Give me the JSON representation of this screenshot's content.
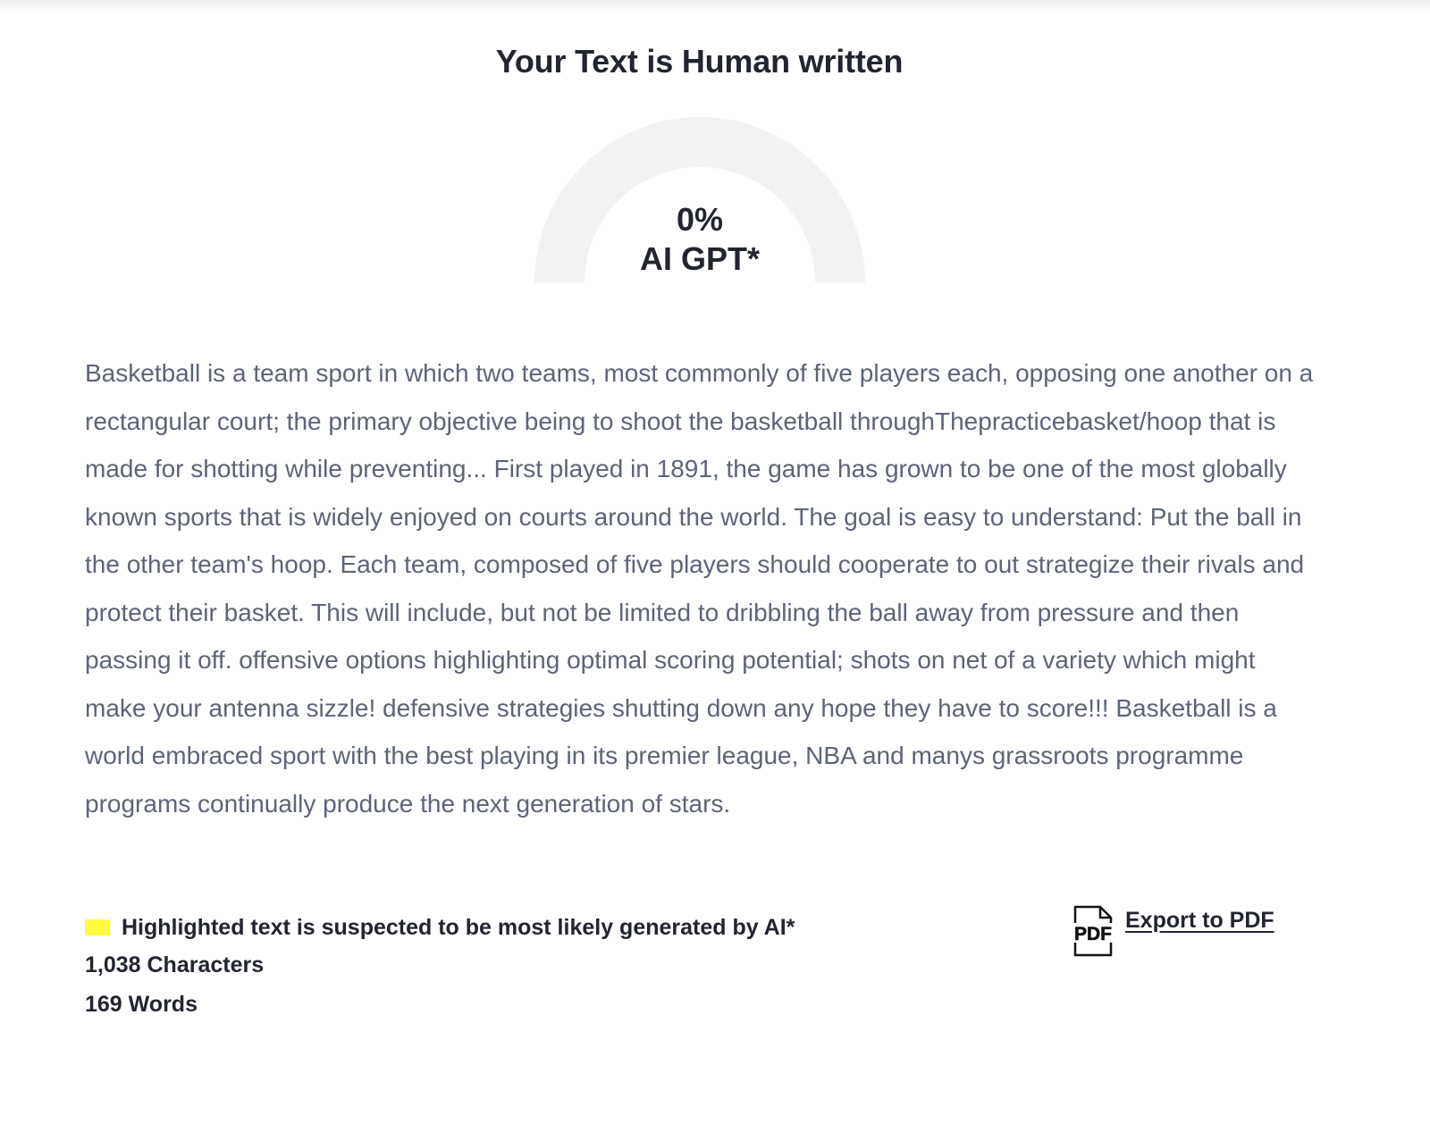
{
  "result": {
    "title": "Your Text is Human written"
  },
  "gauge": {
    "ai_percent": 0,
    "value_text": "0%",
    "label": "AI GPT*",
    "track_color": "#f2f2f2",
    "fill_color": "#fdfd3d"
  },
  "analyzed_text": "Basketball is a team sport in which two teams, most commonly of five players each, opposing one another on a rectangular court; the primary objective being to shoot the basketball throughThepracticebasket/hoop that is made for shotting while preventing... First played in 1891, the game has grown to be one of the most globally known sports that is widely enjoyed on courts around the world. The goal is easy to understand: Put the ball in the other team's hoop. Each team, composed of five players should cooperate to out strategize their rivals and protect their basket. This will include, but not be limited to dribbling the ball away from pressure and then passing it off. offensive options highlighting optimal scoring potential; shots on net of a variety which might make your antenna sizzle! defensive strategies shutting down any hope they have to score!!! Basketball is a world embraced sport with the best playing in its premier league, NBA and manys grassroots programme programs continually produce the next generation of stars.",
  "legend": {
    "text": "Highlighted text is suspected to be most likely generated by AI*",
    "highlight_color": "#fdfd3d"
  },
  "stats": {
    "characters": "1,038 Characters",
    "words": "169 Words"
  },
  "export": {
    "label": "Export to PDF",
    "icon": "pdf-file-icon",
    "icon_text": "PDF"
  }
}
